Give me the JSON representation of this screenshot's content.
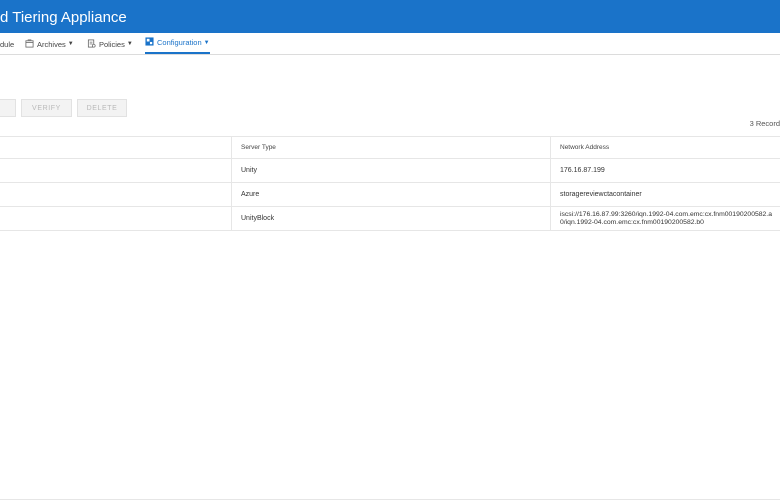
{
  "app": {
    "title": "d Tiering Appliance"
  },
  "nav": {
    "items": [
      {
        "label": "dule"
      },
      {
        "label": "Archives",
        "icon": "archive-icon"
      },
      {
        "label": "Policies",
        "icon": "policy-icon"
      },
      {
        "label": "Configuration",
        "icon": "configuration-icon",
        "active": true
      }
    ]
  },
  "toolbar": {
    "verify_label": "VERIFY",
    "delete_label": "DELETE"
  },
  "records": {
    "count_label": "3 Record"
  },
  "table": {
    "columns": [
      "",
      "Server Type",
      "Network Address"
    ],
    "rows": [
      {
        "server_type": "Unity",
        "address": "176.16.87.199"
      },
      {
        "server_type": "Azure",
        "address": "storagereviewctacontainer"
      },
      {
        "server_type": "UnityBlock",
        "address_line1": "iscsi://176.16.87.99:3260/iqn.1992-04.com.emc:cx.fnm00190200582.a",
        "address_line2": "0/iqn.1992-04.com.emc:cx.fnm00190200582.b0"
      }
    ]
  },
  "colors": {
    "accent": "#1a73c9",
    "header_bar": "#1a73c9"
  }
}
